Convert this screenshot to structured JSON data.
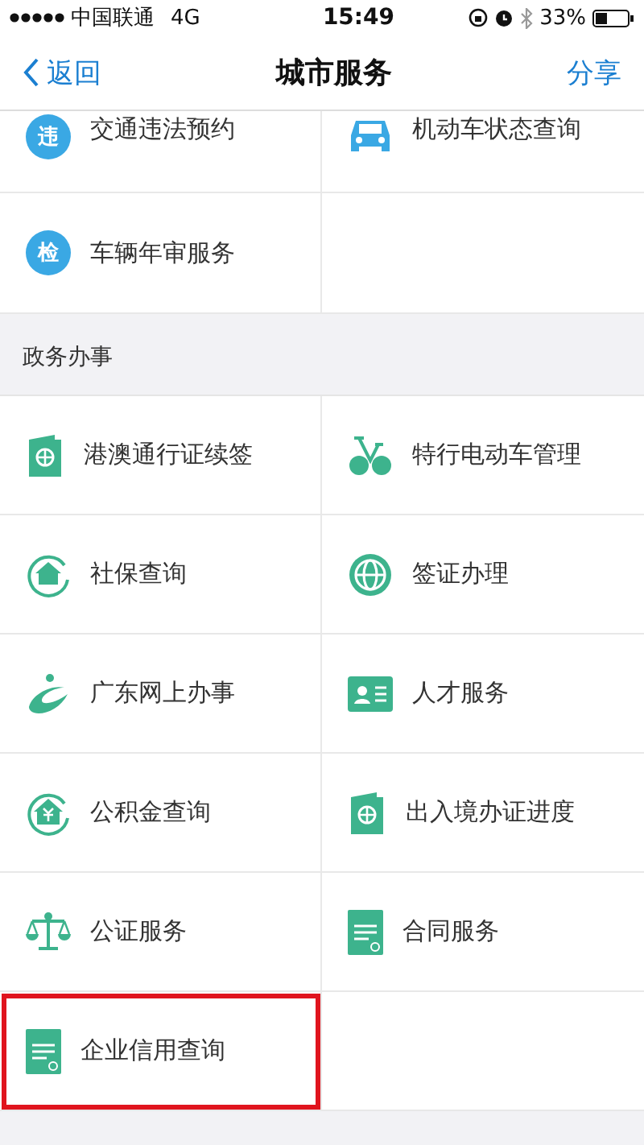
{
  "status_bar": {
    "carrier": "中国联通",
    "network": "4G",
    "time": "15:49",
    "battery": "33%"
  },
  "nav": {
    "back": "返回",
    "title": "城市服务",
    "action": "分享"
  },
  "sections": [
    {
      "items": [
        {
          "label": "交通违法预约",
          "kind": "badge",
          "badge": "违",
          "highlighted": false
        },
        {
          "label": "机动车状态查询",
          "kind": "car",
          "highlighted": false
        },
        {
          "label": "车辆年审服务",
          "kind": "badge",
          "badge": "检",
          "highlighted": false
        }
      ]
    },
    {
      "heading": "政务办事",
      "items": [
        {
          "label": "港澳通行证续签",
          "kind": "passport",
          "highlighted": false
        },
        {
          "label": "特行电动车管理",
          "kind": "bike",
          "highlighted": false
        },
        {
          "label": "社保查询",
          "kind": "home",
          "highlighted": false
        },
        {
          "label": "签证办理",
          "kind": "globe",
          "highlighted": false
        },
        {
          "label": "广东网上办事",
          "kind": "swoosh",
          "highlighted": false
        },
        {
          "label": "人才服务",
          "kind": "idcard",
          "highlighted": false
        },
        {
          "label": "公积金查询",
          "kind": "fund",
          "highlighted": false
        },
        {
          "label": "出入境办证进度",
          "kind": "passport",
          "highlighted": false
        },
        {
          "label": "公证服务",
          "kind": "scale",
          "highlighted": false
        },
        {
          "label": "合同服务",
          "kind": "document",
          "highlighted": false
        },
        {
          "label": "企业信用查询",
          "kind": "document",
          "highlighted": true
        }
      ]
    }
  ]
}
